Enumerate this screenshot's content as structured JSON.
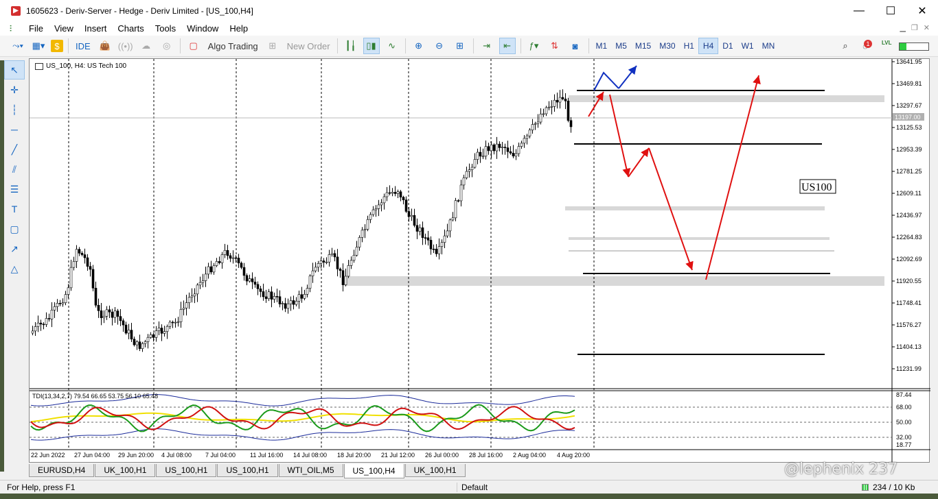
{
  "window": {
    "title": "1605623 - Deriv-Server - Hedge - Deriv Limited - [US_100,H4]",
    "minimize": "—",
    "maximize": "☐",
    "close": "✕"
  },
  "menu": [
    "File",
    "View",
    "Insert",
    "Charts",
    "Tools",
    "Window",
    "Help"
  ],
  "toolbar": {
    "ide_label": "IDE",
    "algo_label": "Algo Trading",
    "new_order_label": "New Order",
    "timeframes": [
      "M1",
      "M5",
      "M15",
      "M30",
      "H1",
      "H4",
      "D1",
      "W1",
      "MN"
    ],
    "active_timeframe": "H4",
    "notification_count": "1",
    "lvl_label": "LVL"
  },
  "chart": {
    "symbol_line": "US_100, H4:  US Tech 100",
    "indicator_line": "TDI(13,34,2,7) 79.54 66.65 53.75 56.10 65.48",
    "annotation_text": "US100",
    "current_price_label": "13197.00",
    "price_axis": [
      "13641.95",
      "13469.81",
      "13297.67",
      "13125.53",
      "12953.39",
      "12781.25",
      "12609.11",
      "12436.97",
      "12264.83",
      "12092.69",
      "11920.55",
      "11748.41",
      "11576.27",
      "11404.13",
      "11231.99"
    ],
    "indicator_axis": [
      "87.44",
      "68.00",
      "50.00",
      "32.00",
      "18.77"
    ],
    "time_axis": [
      "22 Jun 2022",
      "27 Jun 04:00",
      "29 Jun 20:00",
      "4 Jul 08:00",
      "7 Jul 04:00",
      "11 Jul 16:00",
      "14 Jul 08:00",
      "18 Jul 20:00",
      "21 Jul 12:00",
      "26 Jul 00:00",
      "28 Jul 16:00",
      "2 Aug 04:00",
      "4 Aug 20:00"
    ],
    "colors": {
      "bull": "#ffffff",
      "bear": "#000000",
      "arrow_red": "#e01010",
      "arrow_blue": "#1030c0",
      "zone_gray": "#d8d8d8",
      "tdi_green": "#1a9a1a",
      "tdi_red": "#d01010",
      "tdi_yellow": "#f0e000",
      "tdi_blue": "#1a2a9a"
    }
  },
  "tabs": [
    "EURUSD,H4",
    "UK_100,H1",
    "US_100,H1",
    "US_100,H1",
    "WTI_OIL,M5",
    "US_100,H4",
    "UK_100,H1"
  ],
  "active_tab": "US_100,H4",
  "status": {
    "help": "For Help, press F1",
    "profile": "Default",
    "traffic": "234 / 10 Kb"
  },
  "watermark": "@lephenix 237"
}
